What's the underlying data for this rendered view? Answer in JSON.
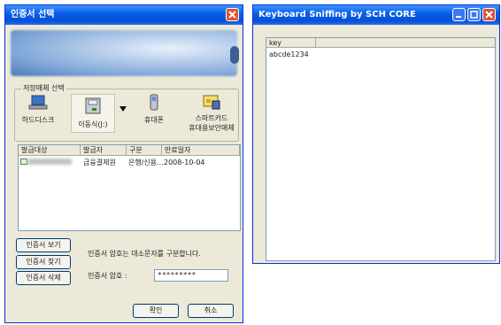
{
  "cert_window": {
    "title": "인증서 선택",
    "storage_group_label": "저장매체 선택",
    "media": [
      {
        "label": "하드디스크",
        "icon": "laptop-icon"
      },
      {
        "label": "이동식(J:)",
        "icon": "removable-disk-icon"
      },
      {
        "label": "휴대폰",
        "icon": "phone-icon"
      },
      {
        "label": "스마트카드",
        "label2": "휴대용보안매체",
        "icon": "smartcard-icon"
      }
    ],
    "columns": [
      "발급대상",
      "발급자",
      "구분",
      "만료일자"
    ],
    "row": {
      "issuer": "금융결제원",
      "type": "은행/신용...",
      "expiry": "2008-10-04"
    },
    "buttons": {
      "view": "인증서 보기",
      "find": "인증서 찾기",
      "delete": "인증서 삭제",
      "ok": "확인",
      "cancel": "취소"
    },
    "case_notice": "인증서 암호는 대소문자를 구분합니다.",
    "password_label": "인증서 암호 :",
    "password_value": "*********"
  },
  "sniff_window": {
    "title": "Keyboard Sniffing by SCH CORE",
    "column": "key",
    "captured": "abcde1234"
  },
  "colors": {
    "titlebar": "#0a5fe8",
    "window_bg": "#ece9d8",
    "close": "#e0512f"
  }
}
